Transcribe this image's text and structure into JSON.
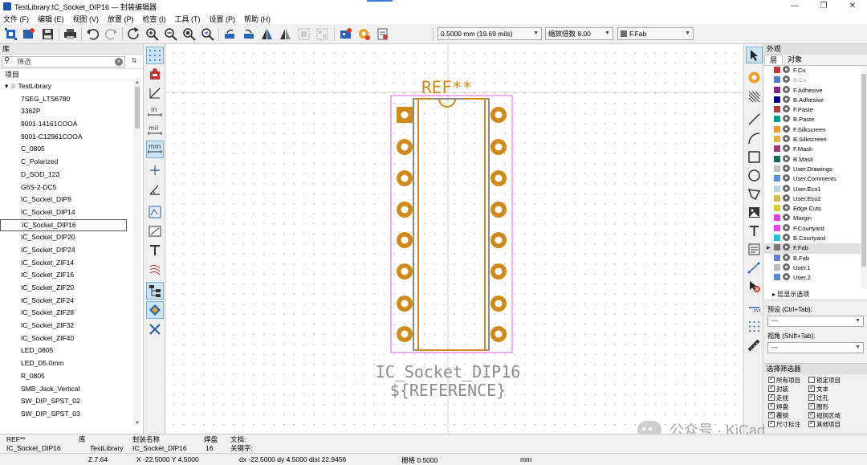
{
  "window": {
    "title": "TestLibrary:IC_Socket_DIP16 — 封装编辑器",
    "minimize": "—",
    "restore": "❐",
    "close": "✕"
  },
  "menu": [
    "文件 (F)",
    "编辑 (E)",
    "视图 (V)",
    "放置 (P)",
    "检查 (I)",
    "工具 (T)",
    "设置 (P)",
    "帮助 (H)"
  ],
  "toolbar": {
    "grid_value": "0.5000 mm (19.69 mils)",
    "zoom_value": "缩放倍数 8.00",
    "layer_value": "F.Fab",
    "layer_color": "#6f6f6f"
  },
  "library": {
    "panel_title": "库",
    "filter_placeholder": "筛选",
    "column_header": "项目",
    "root": "☆ TestLibrary",
    "selected_item": "IC_Socket_DIP16",
    "items": [
      "7SEG_LTS6780",
      "3362P",
      "9001-14161COOA",
      "9001-C12961COOA",
      "C_0805",
      "C_Polarized",
      "D_SOD_123",
      "G6S-2-DC5",
      "IC_Socket_DIP8",
      "IC_Socket_DIP14",
      "IC_Socket_DIP16",
      "IC_Socket_DIP20",
      "IC_Socket_DIP24",
      "IC_Socket_ZIF14",
      "IC_Socket_ZIF16",
      "IC_Socket_ZIF20",
      "IC_Socket_ZIF24",
      "IC_Socket_ZIF28",
      "IC_Socket_ZIF32",
      "IC_Socket_ZIF40",
      "LED_0805",
      "LED_D5.0mm",
      "R_0805",
      "SMB_Jack_Vertical",
      "SW_DIP_SPST_02",
      "SW_DIP_SPST_03"
    ]
  },
  "canvas": {
    "ref_label": "REF**",
    "value_label": "IC_Socket_DIP16",
    "reference_label": "${REFERENCE}",
    "pad_color": "#d08a1a",
    "fab_color": "#d0891a",
    "courtyard_color": "#e05ad8",
    "body_outline_color": "#8c8c8c",
    "silkscreen_value_color": "#8d8d8d"
  },
  "appearance": {
    "panel_title": "外观",
    "tabs": [
      "层",
      "对象"
    ],
    "layers": [
      {
        "name": "F.Cu",
        "color": "#c83434",
        "dim": false
      },
      {
        "name": "B.Cu",
        "color": "#4d7fc4",
        "dim": true
      },
      {
        "name": "F.Adhesive",
        "color": "#842484",
        "dim": false
      },
      {
        "name": "B.Adhesive",
        "color": "#00008b",
        "dim": false
      },
      {
        "name": "F.Paste",
        "color": "#b03a3a",
        "dim": false
      },
      {
        "name": "B.Paste",
        "color": "#00a090",
        "dim": false
      },
      {
        "name": "F.Silkscreen",
        "color": "#f29a2a",
        "dim": false
      },
      {
        "name": "B.Silkscreen",
        "color": "#e8b23a",
        "dim": false
      },
      {
        "name": "F.Mask",
        "color": "#a33a6e",
        "dim": false
      },
      {
        "name": "B.Mask",
        "color": "#116b5a",
        "dim": false
      },
      {
        "name": "User.Drawings",
        "color": "#c2c2c2",
        "dim": false
      },
      {
        "name": "User.Comments",
        "color": "#5a8ed6",
        "dim": false
      },
      {
        "name": "User.Eco1",
        "color": "#b6d6e4",
        "dim": false
      },
      {
        "name": "User.Eco2",
        "color": "#d0c050",
        "dim": false
      },
      {
        "name": "Edge.Cuts",
        "color": "#d6cf30",
        "dim": false
      },
      {
        "name": "Margin",
        "color": "#e63fd4",
        "dim": false
      },
      {
        "name": "F.Courtyard",
        "color": "#ea44e0",
        "dim": false
      },
      {
        "name": "B.Courtyard",
        "color": "#21c4d6",
        "dim": false
      },
      {
        "name": "F.Fab",
        "color": "#7a7a7a",
        "dim": false
      },
      {
        "name": "B.Fab",
        "color": "#5f84d2",
        "dim": false
      },
      {
        "name": "User.1",
        "color": "#bcbcbc",
        "dim": false
      },
      {
        "name": "User.2",
        "color": "#5a86d8",
        "dim": false
      }
    ],
    "selected_layer": "F.Fab",
    "layer_display_options": "层显示选项",
    "preset_label": "预设 (Ctrl+Tab):",
    "preset_value": "---",
    "viewport_label": "视角 (Shift+Tab):",
    "viewport_value": "---"
  },
  "selection_filter": {
    "title": "选择筛选器",
    "items": [
      {
        "label": "所有项目",
        "checked": true
      },
      {
        "label": "锁定项目",
        "checked": false
      },
      {
        "label": "封装",
        "checked": true
      },
      {
        "label": "文本",
        "checked": true
      },
      {
        "label": "走线",
        "checked": true
      },
      {
        "label": "过孔",
        "checked": true
      },
      {
        "label": "焊盘",
        "checked": true
      },
      {
        "label": "图形",
        "checked": true
      },
      {
        "label": "覆铜",
        "checked": true
      },
      {
        "label": "规则区域",
        "checked": true
      },
      {
        "label": "尺寸标注",
        "checked": true
      },
      {
        "label": "其他项目",
        "checked": true
      }
    ]
  },
  "message_panel": {
    "reference_label": "REF**",
    "reference_value": "IC_Socket_DIP16",
    "library_label": "库",
    "library_value": "TestLibrary",
    "footprint_label": "封装名称",
    "footprint_value": "IC_Socket_DIP16",
    "pads_label": "焊盘",
    "pads_value": "16",
    "doc_label": "文档:",
    "keywords_label": "关键字:"
  },
  "status": {
    "zoom": "Z 7.64",
    "xy": "X -22.5000  Y 4.5000",
    "delta": "dx -22.5000  dy 4.5000  dist 22.9456",
    "grid": "栅格 0.5000",
    "units": "mm"
  },
  "watermark": "公众号 · KiCad"
}
